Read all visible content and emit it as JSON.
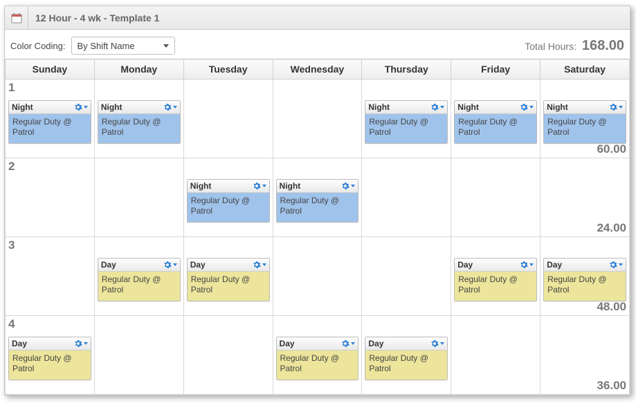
{
  "header": {
    "title": "12 Hour - 4 wk - Template 1"
  },
  "toolbar": {
    "color_coding_label": "Color Coding:",
    "color_coding_value": "By Shift Name",
    "total_hours_label": "Total Hours:",
    "total_hours_value": "168.00"
  },
  "days": [
    "Sunday",
    "Monday",
    "Tuesday",
    "Wednesday",
    "Thursday",
    "Friday",
    "Saturday"
  ],
  "shift_types": {
    "night": {
      "label": "Night",
      "css": "shift-night"
    },
    "day": {
      "label": "Day",
      "css": "shift-day"
    }
  },
  "duty_text": "Regular Duty @ Patrol",
  "weeks": [
    {
      "num": "1",
      "total": "60.00",
      "cells": [
        "night",
        "night",
        "",
        "",
        "night",
        "night",
        "night"
      ]
    },
    {
      "num": "2",
      "total": "24.00",
      "cells": [
        "",
        "",
        "night",
        "night",
        "",
        "",
        ""
      ]
    },
    {
      "num": "3",
      "total": "48.00",
      "cells": [
        "",
        "day",
        "day",
        "",
        "",
        "day",
        "day"
      ]
    },
    {
      "num": "4",
      "total": "36.00",
      "cells": [
        "day",
        "",
        "",
        "day",
        "day",
        "",
        ""
      ]
    }
  ]
}
